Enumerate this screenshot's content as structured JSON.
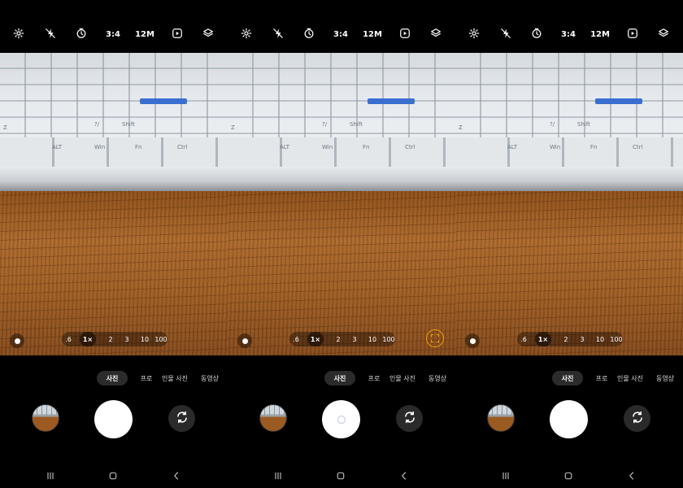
{
  "status": {
    "indicator_color": "#3cc45a"
  },
  "panels": [
    {
      "toolbar": {
        "settings_icon": "gear-icon",
        "flash_icon": "flash-icon",
        "timer_icon": "timer-icon",
        "ratio": "3:4",
        "resolution": "12M",
        "motion_icon": "motion-photo-icon",
        "filter_icon": "filter-layers-icon"
      },
      "zoom": {
        "levels": [
          ".6",
          "1×",
          "2",
          "3",
          "10",
          "100"
        ],
        "active": "1×"
      },
      "focus_ring": false,
      "modes": {
        "active": "사진",
        "items": [
          "프로",
          "인물 사진",
          "동영상"
        ]
      },
      "shutter_pressed": false,
      "nav": {
        "recents_icon": "recents-icon",
        "home_icon": "home-icon",
        "back_icon": "back-icon"
      }
    },
    {
      "toolbar": {
        "settings_icon": "gear-icon",
        "flash_icon": "flash-icon",
        "timer_icon": "timer-icon",
        "ratio": "3:4",
        "resolution": "12M",
        "motion_icon": "motion-photo-icon",
        "filter_icon": "filter-layers-icon"
      },
      "zoom": {
        "levels": [
          ".6",
          "1×",
          "2",
          "3",
          "10",
          "100"
        ],
        "active": "1×"
      },
      "focus_ring": true,
      "modes": {
        "active": "사진",
        "items": [
          "프로",
          "인물 사진",
          "동영상"
        ]
      },
      "shutter_pressed": true,
      "nav": {
        "recents_icon": "recents-icon",
        "home_icon": "home-icon",
        "back_icon": "back-icon"
      }
    },
    {
      "toolbar": {
        "settings_icon": "gear-icon",
        "flash_icon": "flash-icon",
        "timer_icon": "timer-icon",
        "ratio": "3:4",
        "resolution": "12M",
        "motion_icon": "motion-photo-icon",
        "filter_icon": "filter-layers-icon"
      },
      "zoom": {
        "levels": [
          ".6",
          "1×",
          "2",
          "3",
          "10",
          "100"
        ],
        "active": "1×"
      },
      "focus_ring": false,
      "modes": {
        "active": "사진",
        "items": [
          "프로",
          "인물 사진",
          "동영상"
        ]
      },
      "shutter_pressed": false,
      "nav": {
        "recents_icon": "recents-icon",
        "home_icon": "home-icon",
        "back_icon": "back-icon"
      }
    }
  ],
  "keyboard_labels": [
    "ALT",
    "Win",
    "Fn",
    "Ctrl",
    "Shift",
    "Z",
    "?/"
  ],
  "colors": {
    "accent_focus": "#f0a000",
    "background": "#000000",
    "mode_active_bg": "#2b2b2b"
  }
}
